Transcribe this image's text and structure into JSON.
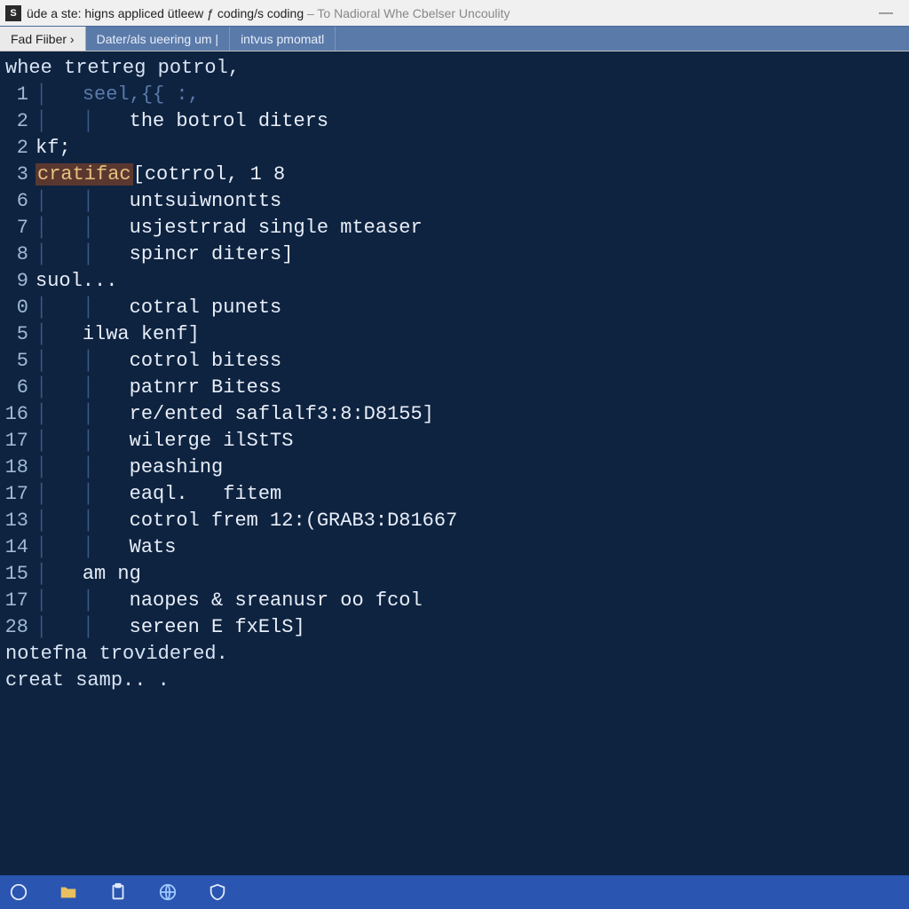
{
  "titlebar": {
    "icon_glyph": "S",
    "primary": "üde a ste: higns appliced ütleew ƒ coding/s coding",
    "secondary": " – To Nadioral Whe Cbelser Uncoulity"
  },
  "tabs": [
    {
      "label": "Fad Fiiber  ›",
      "active": true
    },
    {
      "label": "Dater/als ueering um |",
      "active": false
    },
    {
      "label": "intvus pmomatl",
      "active": false
    }
  ],
  "editor": {
    "header_line": "whee tretreg potrol,",
    "lines": [
      {
        "num": "1",
        "indent": 1,
        "text": "seel,{{ :,",
        "muted": true
      },
      {
        "num": "2",
        "indent": 2,
        "text": "the botrol diters"
      },
      {
        "num": "2",
        "indent": 0,
        "text": "kf;"
      },
      {
        "num": "3",
        "indent": 0,
        "highlight": "cratifac",
        "rest": "[cotrrol, 1 8"
      },
      {
        "num": "6",
        "indent": 2,
        "text": "untsuiwnontts"
      },
      {
        "num": "7",
        "indent": 2,
        "text": "usjestrrad single mteaser"
      },
      {
        "num": "8",
        "indent": 2,
        "text": "spincr diters]"
      },
      {
        "num": "9",
        "indent": 0,
        "text": "suol..."
      },
      {
        "num": "0",
        "indent": 2,
        "text": "cotral punets"
      },
      {
        "num": "5",
        "indent": 1,
        "text": "ilwa kenf]"
      },
      {
        "num": "5",
        "indent": 2,
        "text": "cotrol bitess"
      },
      {
        "num": "6",
        "indent": 2,
        "text": "patnrr Bitess"
      },
      {
        "num": "16",
        "indent": 2,
        "text": "re/ented saflalf3:8:D8155]"
      },
      {
        "num": "17",
        "indent": 2,
        "text": "wilerge ilStTS"
      },
      {
        "num": "18",
        "indent": 2,
        "text": "peashing"
      },
      {
        "num": "17",
        "indent": 2,
        "text": "eaql.   fitem"
      },
      {
        "num": "13",
        "indent": 2,
        "text": "cotrol frem 12:(GRAB3:D81667"
      },
      {
        "num": "14",
        "indent": 2,
        "text": "Wats"
      },
      {
        "num": "15",
        "indent": 1,
        "text": "am ng"
      },
      {
        "num": "17",
        "indent": 2,
        "text": "naopes & sreanusr oo fcol"
      },
      {
        "num": "28",
        "indent": 2,
        "text": "sereen E fxElS]"
      }
    ],
    "footer_lines": [
      "notefna trovidered.",
      "creat samp.. ."
    ]
  },
  "taskbar": {
    "icons": [
      "start",
      "files",
      "clipboard",
      "globe",
      "security"
    ]
  },
  "colors": {
    "editor_bg": "#0e2340",
    "tabrow_bg": "#5a7aaa",
    "taskbar_bg": "#2a55b0",
    "highlight_bg": "#5a3830"
  }
}
